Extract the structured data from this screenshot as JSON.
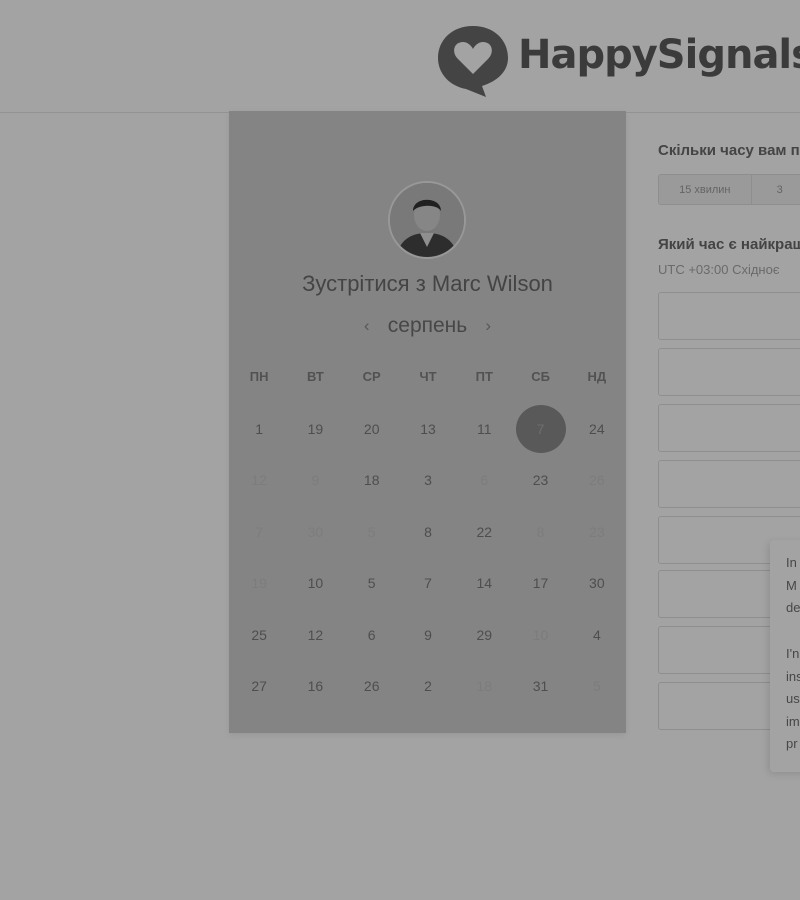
{
  "header": {
    "logo_text": "HappySignals"
  },
  "calendar": {
    "title": "Зустрітися з Marc Wilson",
    "month": "серпень",
    "weekdays": [
      "ПН",
      "ВТ",
      "СР",
      "ЧТ",
      "ПТ",
      "СБ",
      "НД"
    ],
    "days": [
      [
        "1",
        "19",
        "20",
        "13",
        "11",
        "7",
        "24"
      ],
      [
        "12",
        "9",
        "18",
        "3",
        "6",
        "23",
        "26"
      ],
      [
        "7",
        "30",
        "5",
        "8",
        "22",
        "8",
        "23"
      ],
      [
        "19",
        "10",
        "5",
        "7",
        "14",
        "17",
        "30"
      ],
      [
        "25",
        "12",
        "6",
        "9",
        "29",
        "10",
        "4"
      ],
      [
        "27",
        "16",
        "26",
        "2",
        "18",
        "31",
        "5"
      ]
    ],
    "selected_day": "7"
  },
  "booking": {
    "duration_question": "Скільки часу вам п",
    "durations": [
      "15 хвилин",
      "3"
    ],
    "time_question": "Який час є найкращ",
    "timezone": "UTC +03:00 Східноє"
  },
  "popup": {
    "paragraph1": [
      "In",
      "M",
      "de"
    ],
    "paragraph2": [
      "I'n",
      "ins",
      "us",
      "im",
      "pr"
    ]
  },
  "colors": {
    "overlay": "#000000",
    "panel": "#cfcfcf",
    "selected_day": "#8b8b8b"
  }
}
